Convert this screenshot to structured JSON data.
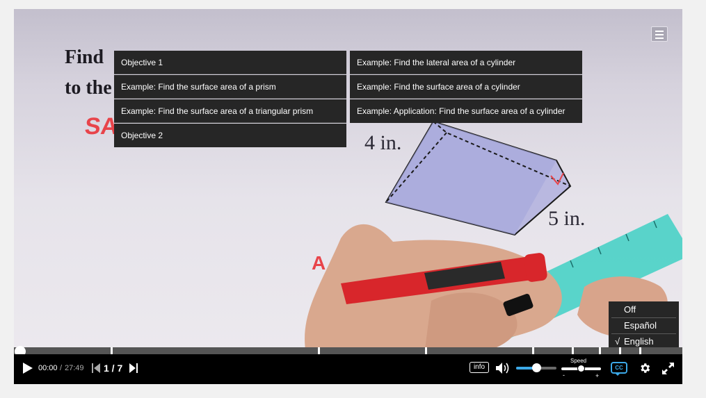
{
  "video": {
    "board_line1": "Find",
    "board_line2": "to the",
    "board_sa": "SA",
    "board_a": "A",
    "dim_4in": "4 in.",
    "dim_5in": "5 in."
  },
  "chapters": [
    "Objective 1",
    "Example: Find the surface area of a prism",
    "Example: Find the surface area of a triangular prism",
    "Objective 2",
    "Example: Find the lateral area of a cylinder",
    "Example: Find the surface area of a cylinder",
    "Example: Application: Find the surface area of a cylinder"
  ],
  "captions_menu": {
    "options": [
      "Off",
      "Español",
      "English"
    ],
    "selected": "English",
    "check": "√"
  },
  "progress": {
    "played_fraction": 0,
    "chapter_marker_fractions": [
      0.145,
      0.455,
      0.615,
      0.775,
      0.835,
      0.875,
      0.905,
      0.935
    ]
  },
  "controls": {
    "current_time": "00:00",
    "separator": "/",
    "duration": "27:49",
    "slide_index": "1 / 7",
    "info_label": "info",
    "volume_level": 0.5,
    "speed_label": "Speed",
    "speed_minus": "-",
    "speed_plus": "+",
    "cc_label": "CC"
  },
  "colors": {
    "accent": "#3ca9e8",
    "menu_bg": "#262626",
    "marker_red": "#e8444a"
  },
  "icons": [
    "play-icon",
    "skip-back-icon",
    "skip-forward-icon",
    "volume-icon",
    "settings-gear-icon",
    "fullscreen-icon",
    "menu-icon"
  ]
}
